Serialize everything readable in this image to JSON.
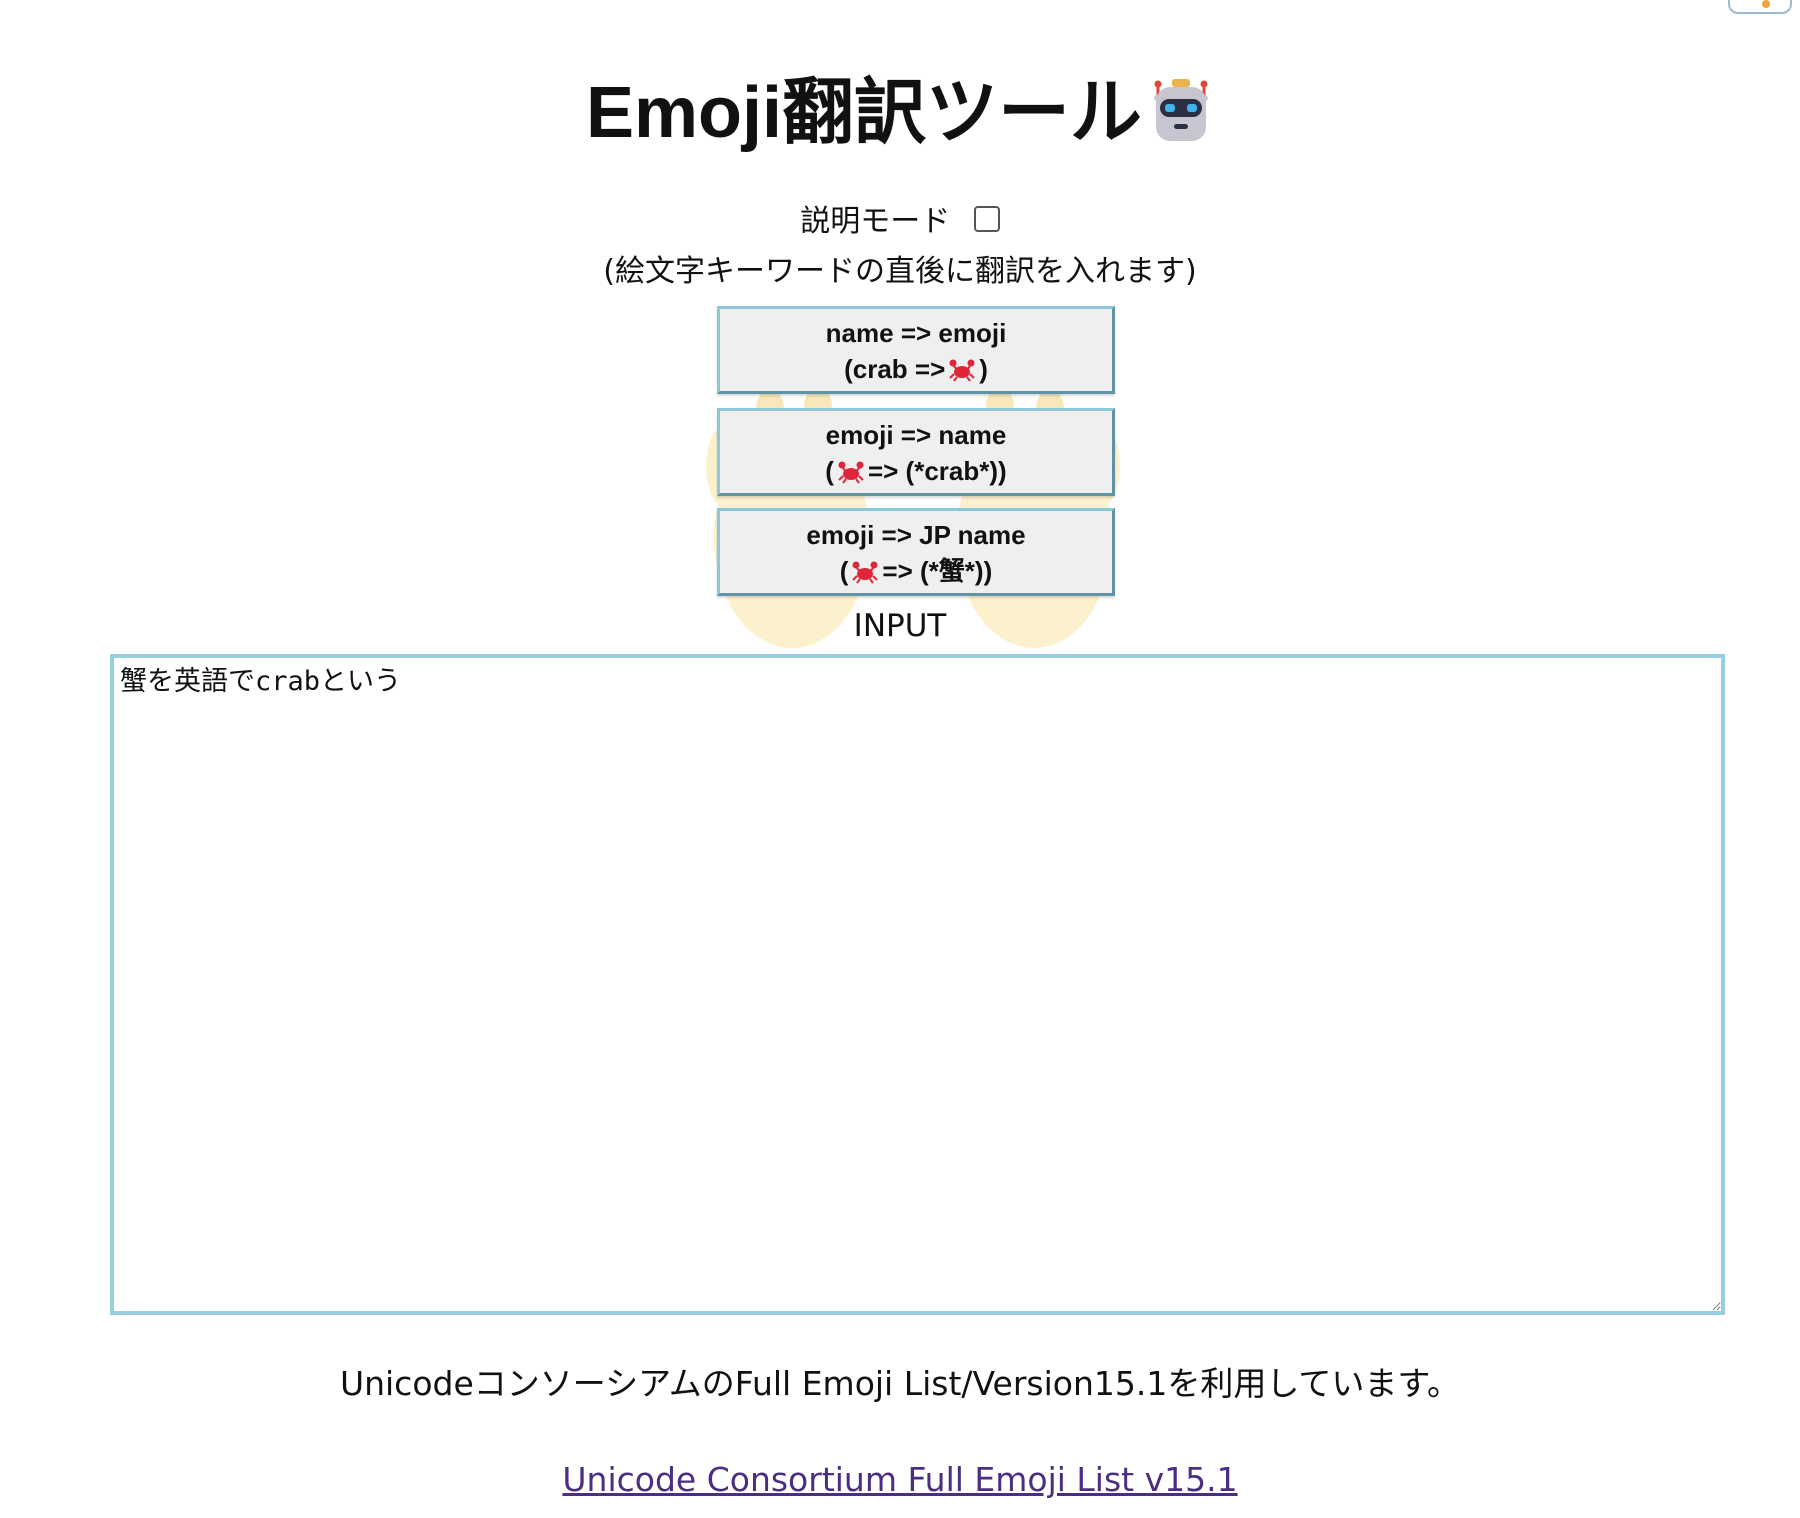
{
  "header": {
    "title": "Emoji翻訳ツール",
    "title_emoji": "robot-icon"
  },
  "mode": {
    "label": "説明モード",
    "checked": false,
    "note": "(絵文字キーワードの直後に翻訳を入れます)"
  },
  "buttons": [
    {
      "line1": "name => emoji",
      "line2_prefix": "(crab =>",
      "line2_suffix": ")"
    },
    {
      "line1": "emoji => name",
      "line2_prefix": "(",
      "line2_suffix": "=> (*crab*))"
    },
    {
      "line1": "emoji => JP name",
      "line2_prefix": "(",
      "line2_suffix": "=> (*蟹*))"
    }
  ],
  "input": {
    "label": "INPUT",
    "value": "蟹を英語でcrabという"
  },
  "footer": {
    "note": "UnicodeコンソーシアムのFull Emoji List/Version15.1を利用しています。",
    "link_text": "Unicode Consortium Full Emoji List v15.1"
  },
  "colors": {
    "button_border": "#8fc7da",
    "input_border": "#97cde0",
    "link": "#4b2e83",
    "crab": "#e0253a"
  }
}
